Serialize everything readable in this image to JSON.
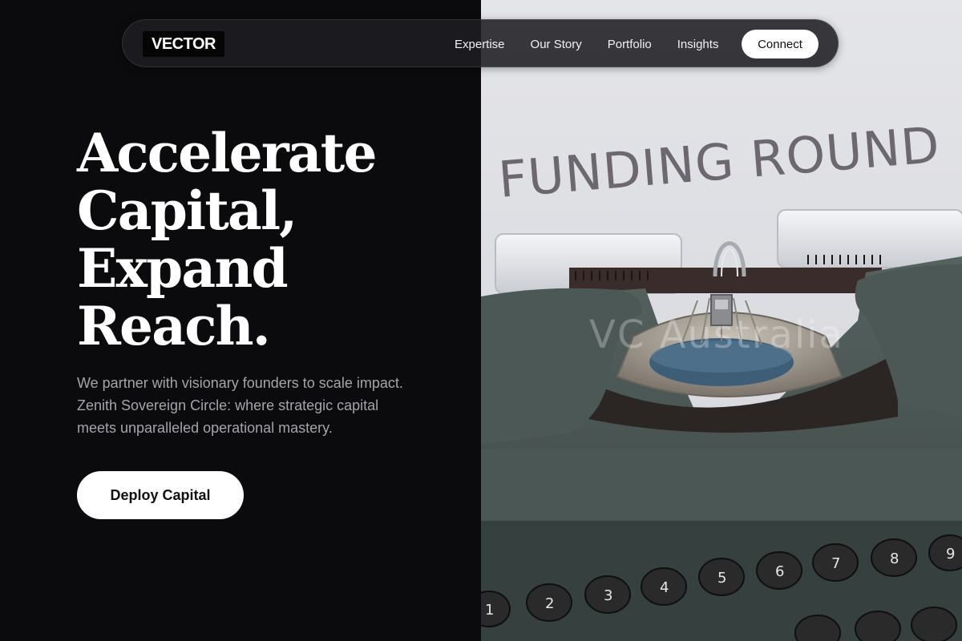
{
  "brand": {
    "logo": "VECTOR"
  },
  "nav": {
    "links": [
      "Expertise",
      "Our Story",
      "Portfolio",
      "Insights"
    ],
    "cta": "Connect"
  },
  "hero": {
    "title_lines": [
      "Accelerate",
      "Capital,",
      "Expand",
      "Reach."
    ],
    "subtitle": "We partner with visionary founders to scale impact. Zenith Sovereign Circle: where strategic capital meets unparalleled operational mastery.",
    "cta": "Deploy Capital"
  },
  "image": {
    "headline": "FUNDING ROUND",
    "watermark": "VC Australia"
  },
  "colors": {
    "background": "#0b0b0d",
    "text": "#ffffff",
    "muted": "#a4a4ab",
    "button_bg": "#ffffff"
  }
}
